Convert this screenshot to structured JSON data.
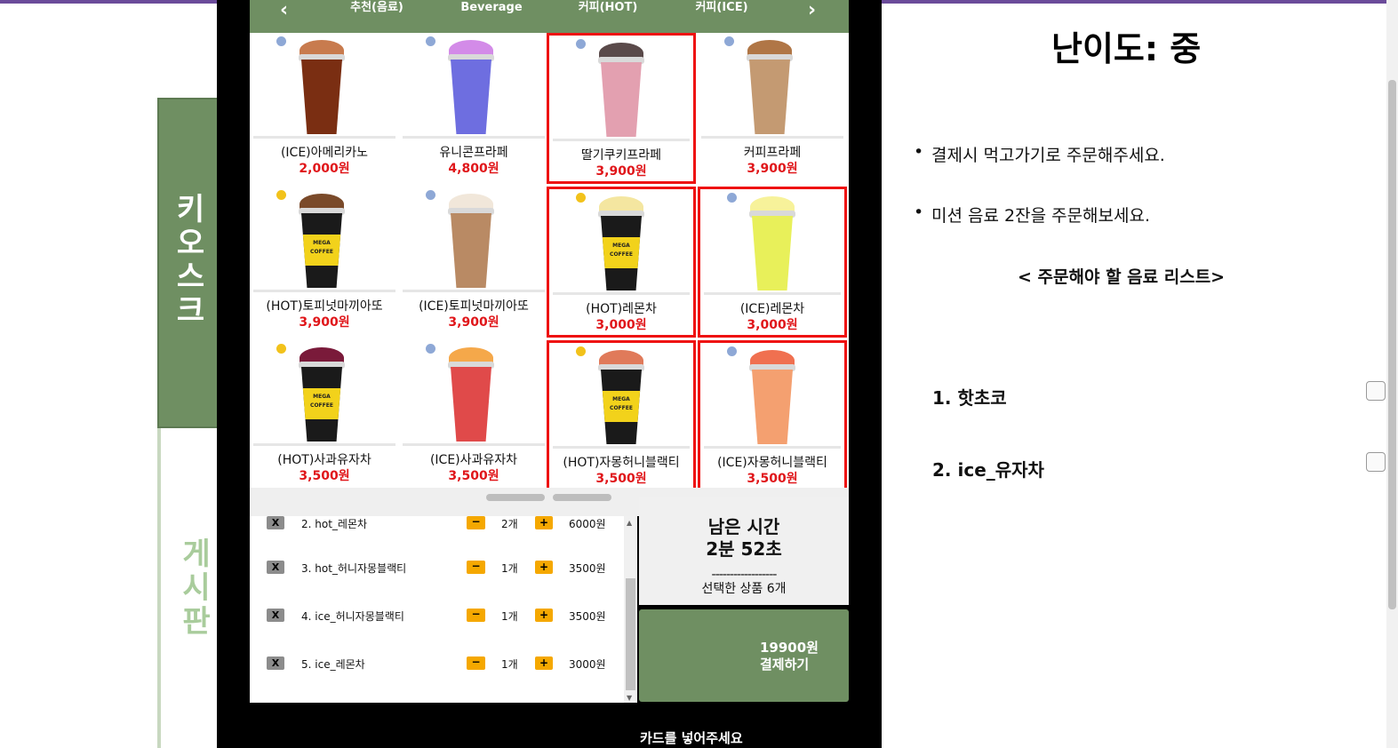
{
  "nav": {
    "kiosk_label": "키\n오\n스\n크",
    "board_label": "게\n시\n판"
  },
  "categories": {
    "prev_icon": "chevron-left",
    "next_icon": "chevron-right",
    "tabs": [
      "추천(음료)",
      "Beverage",
      "커피(HOT)",
      "커피(ICE)"
    ]
  },
  "menu": [
    {
      "name": "(ICE)아메리카노",
      "price": "2,000원",
      "temp": "ICE",
      "color": "#7a2e12",
      "top": "#c87b4e"
    },
    {
      "name": "유니콘프라페",
      "price": "4,800원",
      "temp": "ICE",
      "color": "#6e6ee0",
      "top": "#d38be8"
    },
    {
      "name": "딸기쿠키프라페",
      "price": "3,900원",
      "temp": "ICE",
      "color": "#e3a0b0",
      "top": "#5a4a4a"
    },
    {
      "name": "커피프라페",
      "price": "3,900원",
      "temp": "ICE",
      "color": "#c49a72",
      "top": "#b07646"
    },
    {
      "name": "(HOT)토피넛마끼아또",
      "price": "3,900원",
      "temp": "HOT",
      "color": "#1a1a1a",
      "top": "#7a4a2a"
    },
    {
      "name": "(ICE)토피넛마끼아또",
      "price": "3,900원",
      "temp": "ICE",
      "color": "#b98a64",
      "top": "#f1e7da"
    },
    {
      "name": "(HOT)레몬차",
      "price": "3,000원",
      "temp": "HOT",
      "color": "#1a1a1a",
      "top": "#f4e6a0"
    },
    {
      "name": "(ICE)레몬차",
      "price": "3,000원",
      "temp": "ICE",
      "color": "#e8f05a",
      "top": "#f7f29a"
    },
    {
      "name": "(HOT)사과유자차",
      "price": "3,500원",
      "temp": "HOT",
      "color": "#1a1a1a",
      "top": "#7a1a3a"
    },
    {
      "name": "(ICE)사과유자차",
      "price": "3,500원",
      "temp": "ICE",
      "color": "#e04a4a",
      "top": "#f5a84a"
    },
    {
      "name": "(HOT)자몽허니블랙티",
      "price": "3,500원",
      "temp": "HOT",
      "color": "#1a1a1a",
      "top": "#e07a5a"
    },
    {
      "name": "(ICE)자몽허니블랙티",
      "price": "3,500원",
      "temp": "ICE",
      "color": "#f4a070",
      "top": "#f07050"
    }
  ],
  "order": {
    "rows": [
      {
        "remove": "X",
        "name": "2. hot_레몬차",
        "minus": "−",
        "qty": "2개",
        "plus": "+",
        "price": "6000원"
      },
      {
        "remove": "X",
        "name": "3. hot_허니자몽블랙티",
        "minus": "−",
        "qty": "1개",
        "plus": "+",
        "price": "3500원"
      },
      {
        "remove": "X",
        "name": "4. ice_허니자몽블랙티",
        "minus": "−",
        "qty": "1개",
        "plus": "+",
        "price": "3500원"
      },
      {
        "remove": "X",
        "name": "5. ice_레몬차",
        "minus": "−",
        "qty": "1개",
        "plus": "+",
        "price": "3000원"
      }
    ],
    "scroll_up": "▲",
    "scroll_down": "▼"
  },
  "timer": {
    "label": "남은 시간",
    "value": "2분 52초",
    "divider": "------------------",
    "selected": "선택한 상품 6개"
  },
  "pay": {
    "amount": "19900원",
    "label": "결제하기"
  },
  "card_prompt": "카드를 넣어주세요",
  "panel": {
    "title": "난이도: 중",
    "bullets": [
      "결제시 먹고가기로 주문해주세요.",
      "미션 음료 2잔을 주문해보세요."
    ],
    "list_header": "< 주문해야 할 음료 리스트>",
    "items": [
      "1. 핫초코",
      "2. ice_유자차"
    ]
  },
  "colors": {
    "accent": "#6f8f62",
    "price": "#e0161a",
    "highlight": "#e11111",
    "button": "#f5a800"
  }
}
